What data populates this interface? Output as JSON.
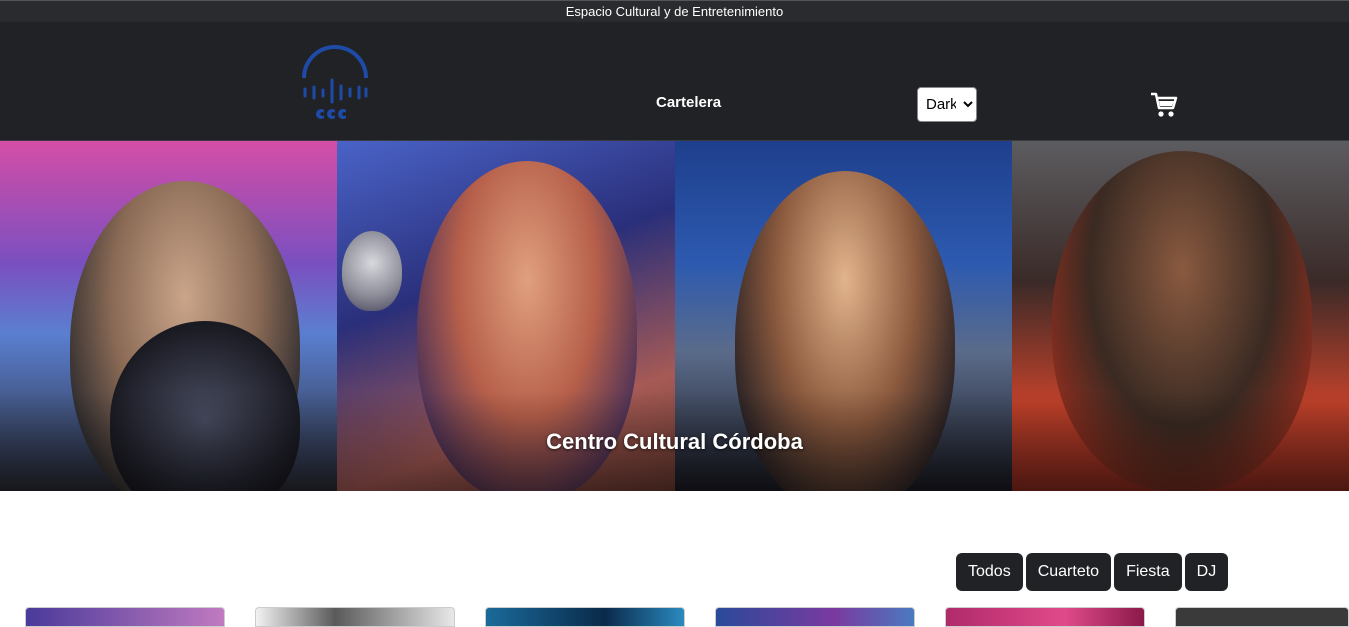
{
  "topbar": {
    "text": "Espacio Cultural y de Entretenimiento"
  },
  "header": {
    "nav": {
      "cartelera": "Cartelera"
    },
    "theme_select": {
      "value": "Dark",
      "options": [
        "Dark"
      ]
    },
    "cart_icon": "cart-icon",
    "logo_icon": "ccc-logo"
  },
  "hero": {
    "title": "Centro Cultural Córdoba"
  },
  "filters": {
    "todos": "Todos",
    "cuarteto": "Cuarteto",
    "fiesta": "Fiesta",
    "dj": "DJ"
  },
  "colors": {
    "header_bg": "#212226",
    "accent": "#1e4aa8",
    "button_bg": "#212226"
  }
}
